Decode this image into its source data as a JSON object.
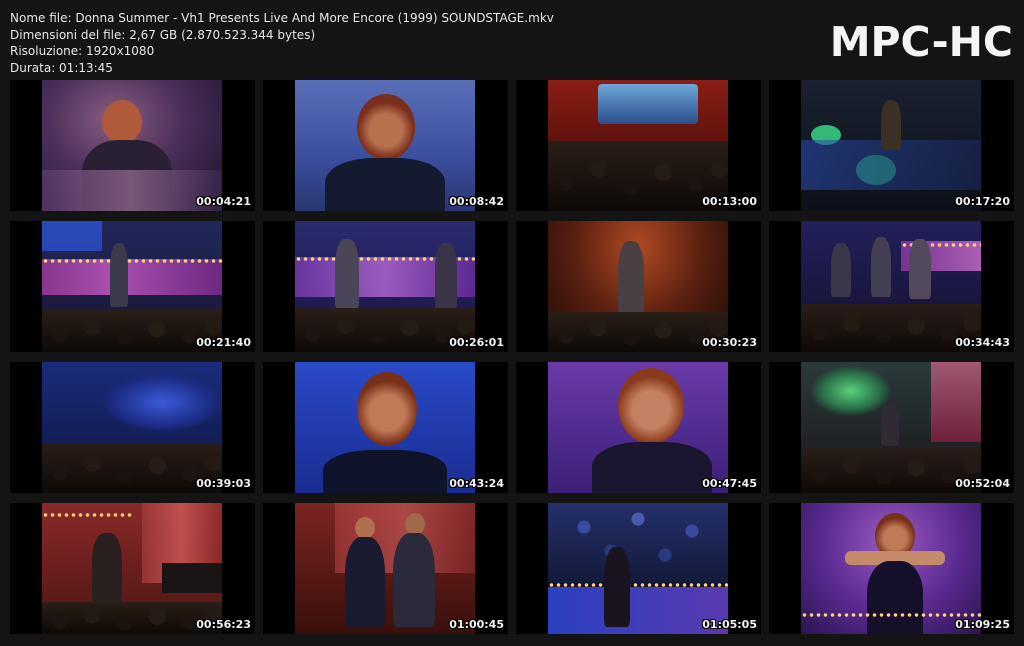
{
  "info": {
    "filename_line": "Nome file: Donna Summer - Vh1 Presents Live And More Encore (1999) SOUNDSTAGE.mkv",
    "filesize_line": "Dimensioni del file: 2,67 GB (2.870.523.344 bytes)",
    "resolution_line": "Risoluzione: 1920x1080",
    "duration_line": "Durata: 01:13:45"
  },
  "brand": "MPC-HC",
  "thumbnails": [
    {
      "time": "00:04:21",
      "scene": "closeup-mauve"
    },
    {
      "time": "00:08:42",
      "scene": "closeup-blue-singing"
    },
    {
      "time": "00:13:00",
      "scene": "wide-red-stage"
    },
    {
      "time": "00:17:20",
      "scene": "dark-stage-green-lights"
    },
    {
      "time": "00:21:40",
      "scene": "stage-purple-lights"
    },
    {
      "time": "00:26:01",
      "scene": "stage-purple-band"
    },
    {
      "time": "00:30:23",
      "scene": "stage-orange"
    },
    {
      "time": "00:34:43",
      "scene": "stage-band-blue"
    },
    {
      "time": "00:39:03",
      "scene": "wide-blue-arena"
    },
    {
      "time": "00:43:24",
      "scene": "closeup-blue-singing"
    },
    {
      "time": "00:47:45",
      "scene": "closeup-purple-singing"
    },
    {
      "time": "00:52:04",
      "scene": "wide-green-stage"
    },
    {
      "time": "00:56:23",
      "scene": "guitarist-red"
    },
    {
      "time": "01:00:45",
      "scene": "duet-red"
    },
    {
      "time": "01:05:05",
      "scene": "stage-crowd-blue"
    },
    {
      "time": "01:09:25",
      "scene": "closeup-purple-arms"
    }
  ]
}
